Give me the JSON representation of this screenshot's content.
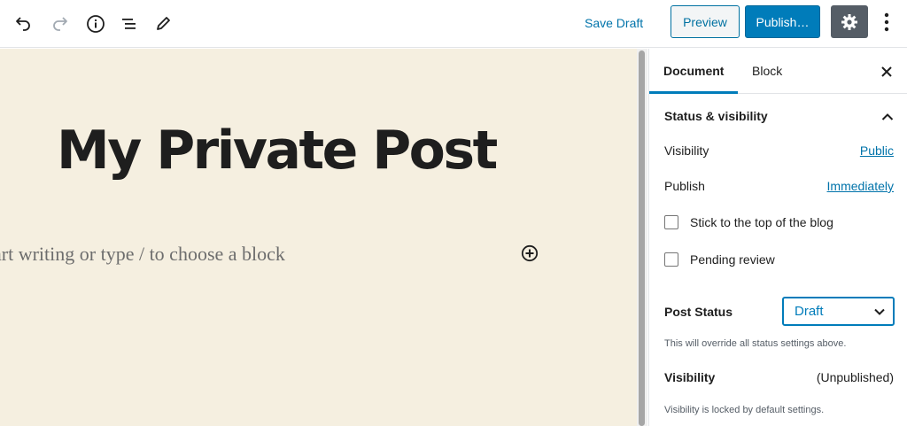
{
  "toolbar": {
    "undo_icon": "undo-icon",
    "redo_icon": "redo-icon",
    "info_icon": "info-icon",
    "outline_icon": "list-outline-icon",
    "tools_icon": "pencil-icon",
    "save_draft_label": "Save Draft",
    "preview_label": "Preview",
    "publish_label": "Publish…",
    "settings_icon": "gear-icon",
    "more_icon": "more-vertical-icon"
  },
  "editor": {
    "title": "My Private Post",
    "placeholder": "art writing or type / to choose a block",
    "inserter_icon": "plus-circle-icon",
    "background_color": "#f5efe0"
  },
  "sidebar": {
    "tabs": [
      {
        "label": "Document",
        "active": true
      },
      {
        "label": "Block",
        "active": false
      }
    ],
    "close_icon": "close-icon",
    "panel": {
      "title": "Status & visibility",
      "expanded": true,
      "visibility_label": "Visibility",
      "visibility_value": "Public",
      "publish_label": "Publish",
      "publish_value": "Immediately",
      "checkboxes": [
        {
          "label": "Stick to the top of the blog",
          "checked": false
        },
        {
          "label": "Pending review",
          "checked": false
        }
      ],
      "post_status_label": "Post Status",
      "post_status_value": "Draft",
      "post_status_help": "This will override all status settings above.",
      "locked_visibility_label": "Visibility",
      "locked_visibility_value": "(Unpublished)",
      "locked_visibility_help": "Visibility is locked by default settings."
    }
  },
  "colors": {
    "accent": "#007cba",
    "link": "#0073aa",
    "settings_button": "#555d66"
  }
}
